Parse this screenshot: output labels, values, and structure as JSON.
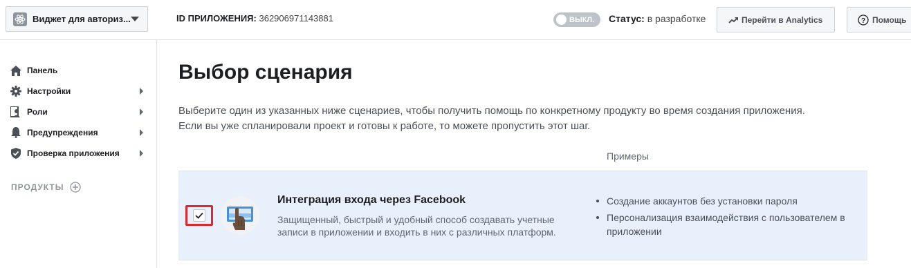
{
  "header": {
    "app_selector_label": "Виджет для авториз...",
    "app_id_label": "ID ПРИЛОЖЕНИЯ:",
    "app_id_value": "362906971143881",
    "toggle_label": "ВЫКЛ.",
    "status_label": "Статус:",
    "status_value": "в разработке",
    "analytics_button": "Перейти в Analytics",
    "help_button": "Помощь"
  },
  "sidebar": {
    "items": [
      {
        "label": "Панель",
        "icon": "home-icon",
        "has_submenu": false
      },
      {
        "label": "Настройки",
        "icon": "gear-icon",
        "has_submenu": true
      },
      {
        "label": "Роли",
        "icon": "roles-icon",
        "has_submenu": true
      },
      {
        "label": "Предупреждения",
        "icon": "bell-icon",
        "has_submenu": true
      },
      {
        "label": "Проверка приложения",
        "icon": "shield-icon",
        "has_submenu": true
      }
    ],
    "products_label": "ПРОДУКТЫ"
  },
  "main": {
    "title": "Выбор сценария",
    "intro_line1": "Выберите один из указанных ниже сценариев, чтобы получить помощь по конкретному продукту во время создания приложения.",
    "intro_line2": "Если вы уже спланировали проект и готовы к работе, то можете пропустить этот шаг.",
    "examples_header": "Примеры",
    "scenario": {
      "checked": true,
      "title": "Интеграция входа через Facebook",
      "description": "Защищенный, быстрый и удобный способ создавать учетные записи в приложении и входить в них с различных платформ.",
      "examples": [
        "Создание аккаунтов без установки пароля",
        "Персонализация взаимодействия с пользователем в приложении"
      ]
    }
  },
  "colors": {
    "card_bg": "#e7f0fb",
    "highlight_red": "#e0272e",
    "toggle_off": "#bec3c9"
  }
}
